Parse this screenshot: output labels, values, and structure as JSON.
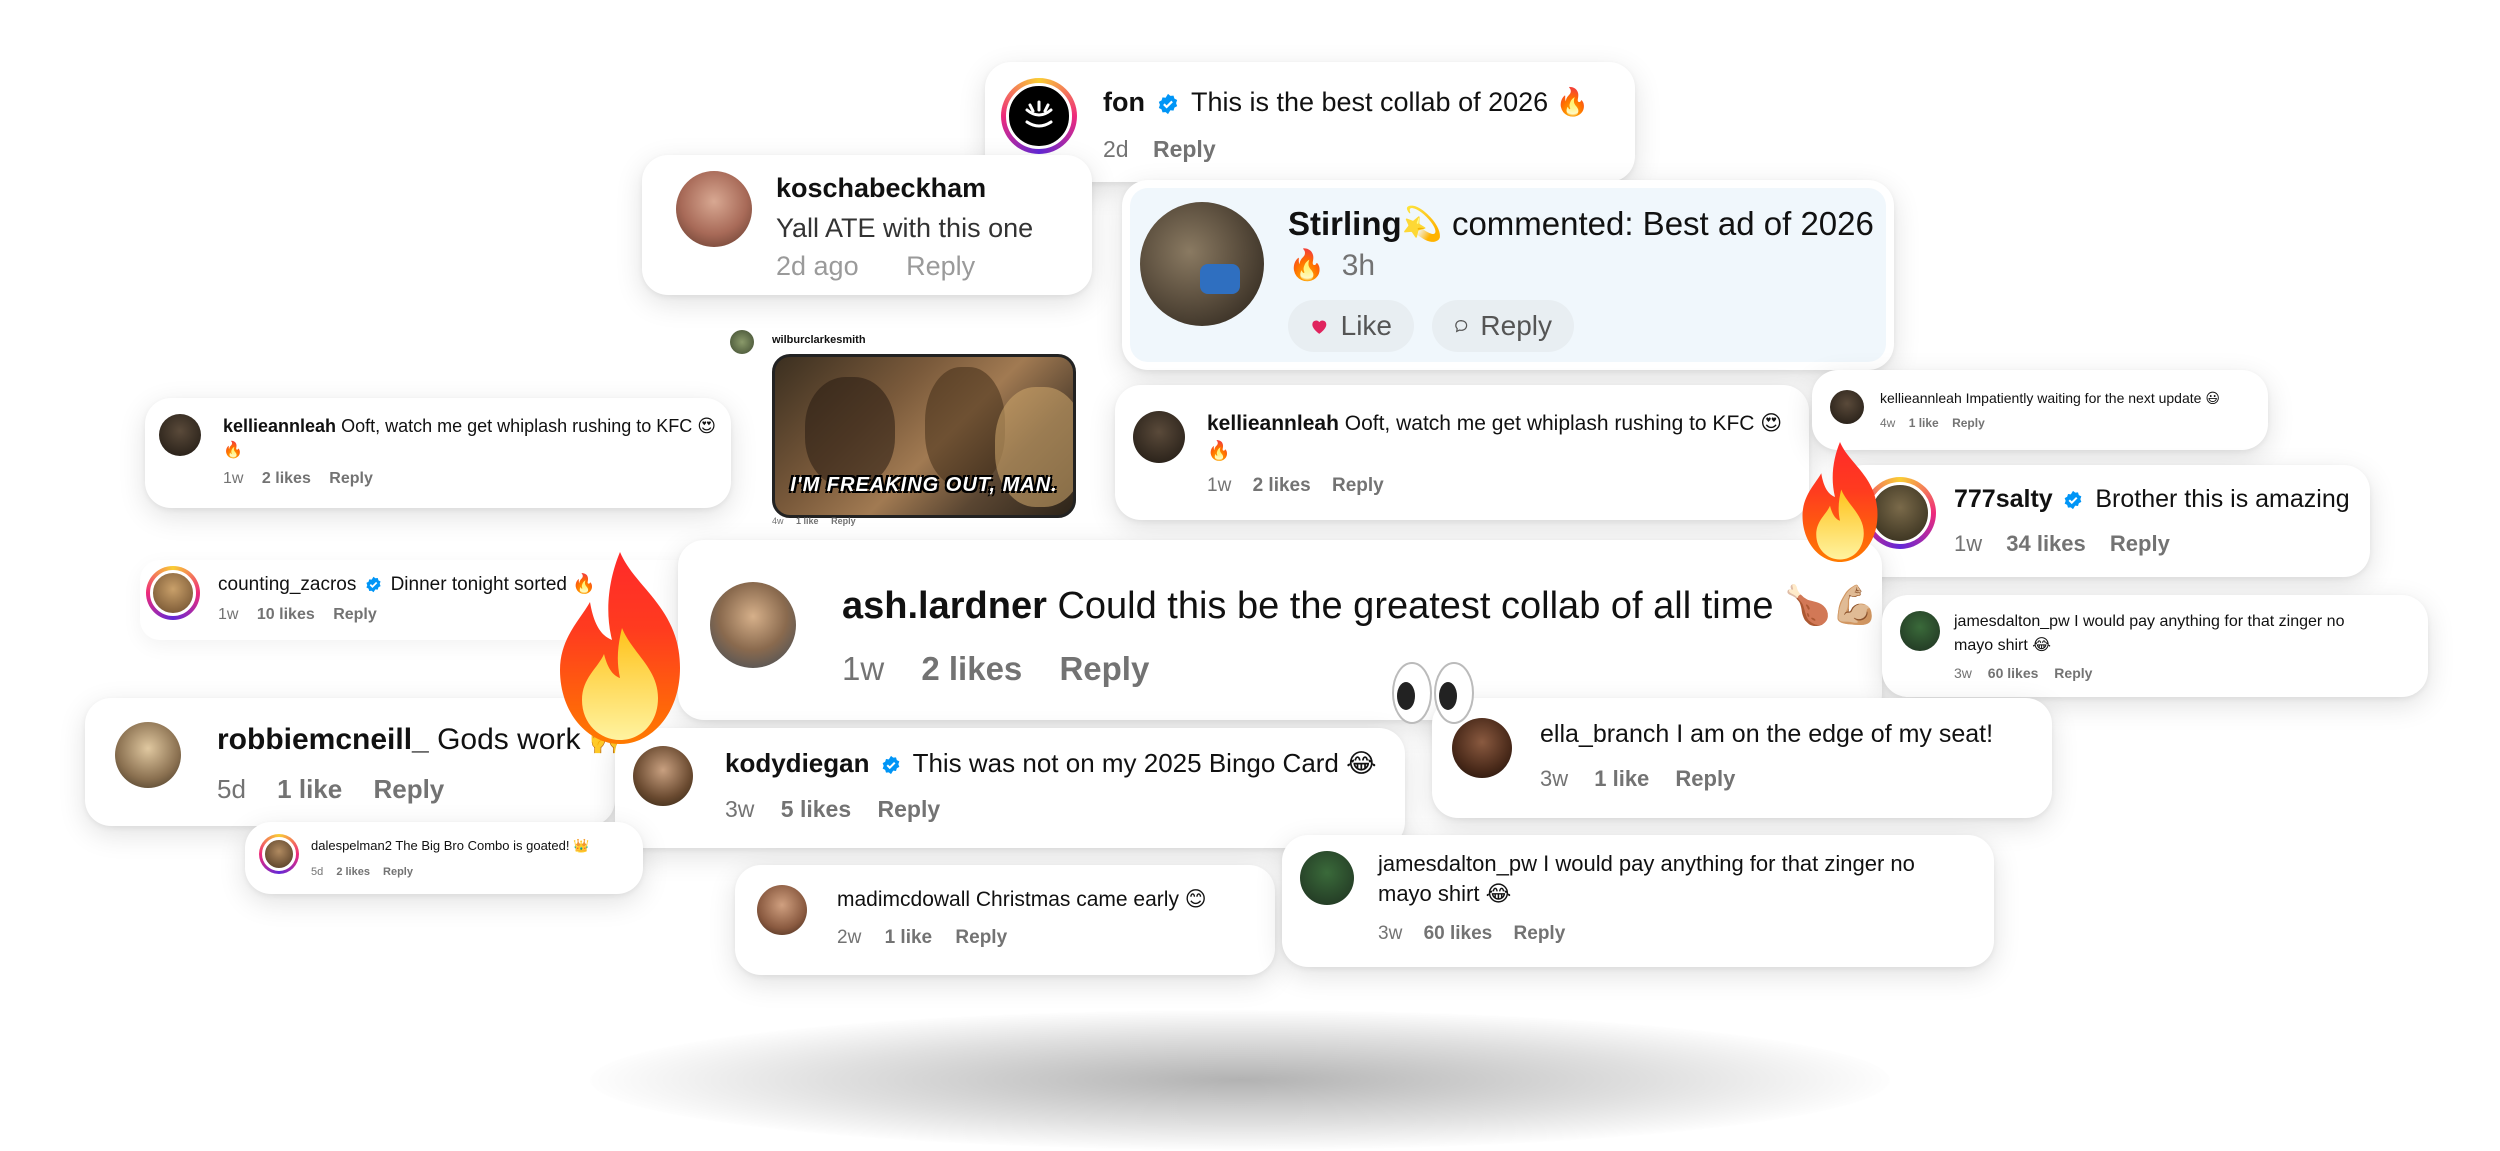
{
  "icons": {
    "verified_color": "#0095f6",
    "like_heart_color": "#e0245e",
    "fire": "fire-emoji",
    "eyes": "eyes-emoji"
  },
  "comments": {
    "fon": {
      "username": "fon",
      "text": "This is the best collab of 2026 🔥",
      "time": "2d",
      "reply": "Reply"
    },
    "kosch": {
      "username": "koschabeckham",
      "text": "Yall ATE with this one",
      "time": "2d ago",
      "reply": "Reply"
    },
    "stirling": {
      "username": "Stirling",
      "badge": "💫",
      "text": "commented: Best ad of 2026",
      "fire": "🔥",
      "time": "3h",
      "like": "Like",
      "reply": "Reply"
    },
    "gif": {
      "username": "wilburclarkesmith",
      "caption": "I'M FREAKING OUT, MAN.",
      "time": "4w",
      "likes": "1 like",
      "reply": "Reply"
    },
    "kellie1": {
      "username": "kellieannleah",
      "text": "Ooft, watch me get whiplash rushing to KFC 😍",
      "text2": "🔥",
      "time": "1w",
      "likes": "2 likes",
      "reply": "Reply"
    },
    "kellie2": {
      "username": "kellieannleah",
      "text": "Ooft, watch me get whiplash rushing to KFC 😍",
      "text2": "🔥",
      "time": "1w",
      "likes": "2 likes",
      "reply": "Reply"
    },
    "kellie3": {
      "username": "kellieannleah",
      "text": "Impatiently waiting for the next update 😃",
      "time": "4w",
      "likes": "1 like",
      "reply": "Reply"
    },
    "salty": {
      "username": "777salty",
      "text": "Brother this is amazing",
      "time": "1w",
      "likes": "34 likes",
      "reply": "Reply"
    },
    "counting": {
      "username": "counting_zacros",
      "text": "Dinner tonight sorted 🔥",
      "time": "1w",
      "likes": "10 likes",
      "reply": "Reply"
    },
    "ash": {
      "username": "ash.lardner",
      "text": "Could this be the greatest collab of all time 🍗💪🏼",
      "time": "1w",
      "likes": "2 likes",
      "reply": "Reply"
    },
    "james1": {
      "username": "jamesdalton_pw",
      "text": "I would pay anything for that zinger no",
      "text2": "mayo shirt 😂",
      "time": "3w",
      "likes": "60 likes",
      "reply": "Reply"
    },
    "robbie": {
      "username": "robbiemcneill_",
      "text": "Gods work 🙌",
      "time": "5d",
      "likes": "1 like",
      "reply": "Reply"
    },
    "kody": {
      "username": "kodydiegan",
      "text": "This was not on my 2025 Bingo Card 😂",
      "time": "3w",
      "likes": "5 likes",
      "reply": "Reply"
    },
    "ella": {
      "username": "ella_branch",
      "text": "I am on the edge of my seat!",
      "time": "3w",
      "likes": "1 like",
      "reply": "Reply"
    },
    "dale": {
      "username": "dalespelman2",
      "text": "The Big Bro Combo is goated! 👑",
      "time": "5d",
      "likes": "2 likes",
      "reply": "Reply"
    },
    "madi": {
      "username": "madimcdowall",
      "text": "Christmas came early 😊",
      "time": "2w",
      "likes": "1 like",
      "reply": "Reply"
    },
    "james2": {
      "username": "jamesdalton_pw",
      "text": "I would pay anything for that zinger no",
      "text2": "mayo shirt 😂",
      "time": "3w",
      "likes": "60 likes",
      "reply": "Reply"
    }
  }
}
